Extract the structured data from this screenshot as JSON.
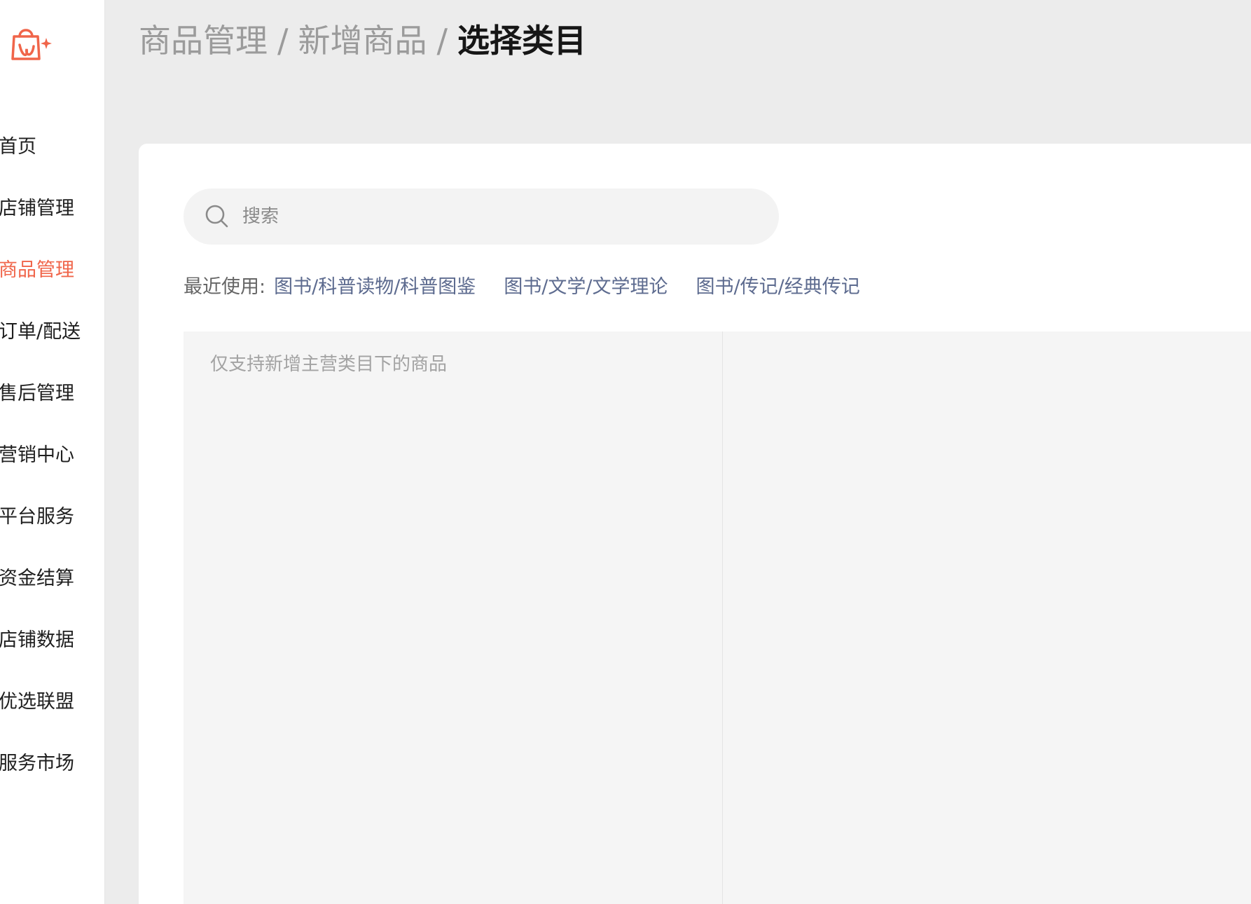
{
  "sidebar": {
    "items": [
      {
        "label": "首页"
      },
      {
        "label": "店铺管理"
      },
      {
        "label": "商品管理",
        "active": true
      },
      {
        "label": "订单/配送"
      },
      {
        "label": "售后管理"
      },
      {
        "label": "营销中心"
      },
      {
        "label": "平台服务"
      },
      {
        "label": "资金结算"
      },
      {
        "label": "店铺数据"
      },
      {
        "label": "优选联盟"
      },
      {
        "label": "服务市场"
      }
    ],
    "accent_color": "#f0654a"
  },
  "breadcrumb": {
    "level1": "商品管理",
    "level2": "新增商品",
    "current": "选择类目",
    "separator": "/"
  },
  "search": {
    "placeholder": "搜索",
    "icon": "search-icon"
  },
  "recent": {
    "label": "最近使用:",
    "links": [
      "图书/科普读物/科普图鉴",
      "图书/文学/文学理论",
      "图书/传记/经典传记"
    ],
    "link_color": "#5d6b8f"
  },
  "category_panel": {
    "hint": "仅支持新增主营类目下的商品"
  }
}
